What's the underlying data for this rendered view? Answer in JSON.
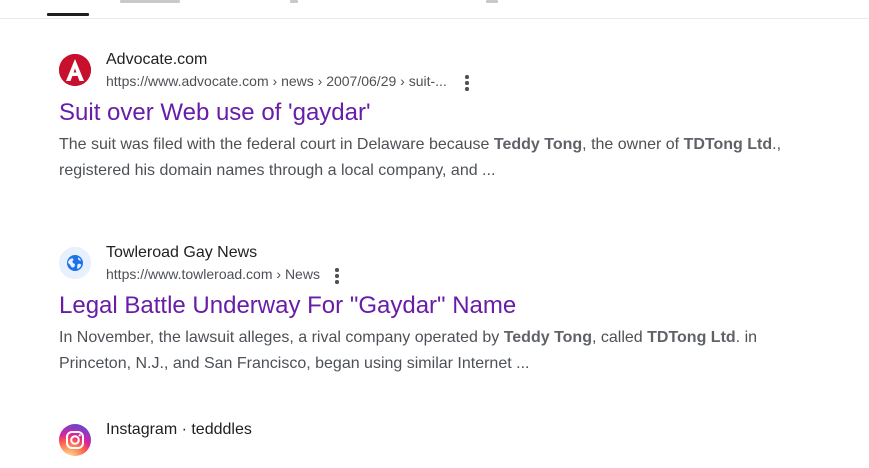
{
  "results": [
    {
      "site_name": "Advocate.com",
      "url": "https://www.advocate.com › news › 2007/06/29 › suit-...",
      "title": "Suit over Web use of 'gaydar'",
      "snippet": [
        {
          "t": "The suit was filed with the federal court in Delaware because ",
          "b": false
        },
        {
          "t": "Teddy Tong",
          "b": true
        },
        {
          "t": ", the owner of ",
          "b": false
        },
        {
          "t": "TDTong Ltd",
          "b": true
        },
        {
          "t": "., registered his domain names through a local company, and ...",
          "b": false
        }
      ],
      "favicon": "advocate-a-logo-icon",
      "favicon_color": "#c8102e"
    },
    {
      "site_name": "Towleroad Gay News",
      "url": "https://www.towleroad.com › News",
      "title": "Legal Battle Underway For \"Gaydar\" Name",
      "snippet": [
        {
          "t": "In November, the lawsuit alleges, a rival company operated by ",
          "b": false
        },
        {
          "t": "Teddy Tong",
          "b": true
        },
        {
          "t": ", called ",
          "b": false
        },
        {
          "t": "TDTong Ltd",
          "b": true
        },
        {
          "t": ". in Princeton, N.J., and San Francisco, began using similar Internet ...",
          "b": false
        }
      ],
      "favicon": "globe-icon",
      "favicon_color": "#1a73e8"
    },
    {
      "site_name": "Instagram · tedddles",
      "favicon": "instagram-icon"
    }
  ],
  "colors": {
    "title_visited": "#681da8",
    "snippet_text": "#4d5156",
    "tab_indicator": "#1f1f1f"
  }
}
